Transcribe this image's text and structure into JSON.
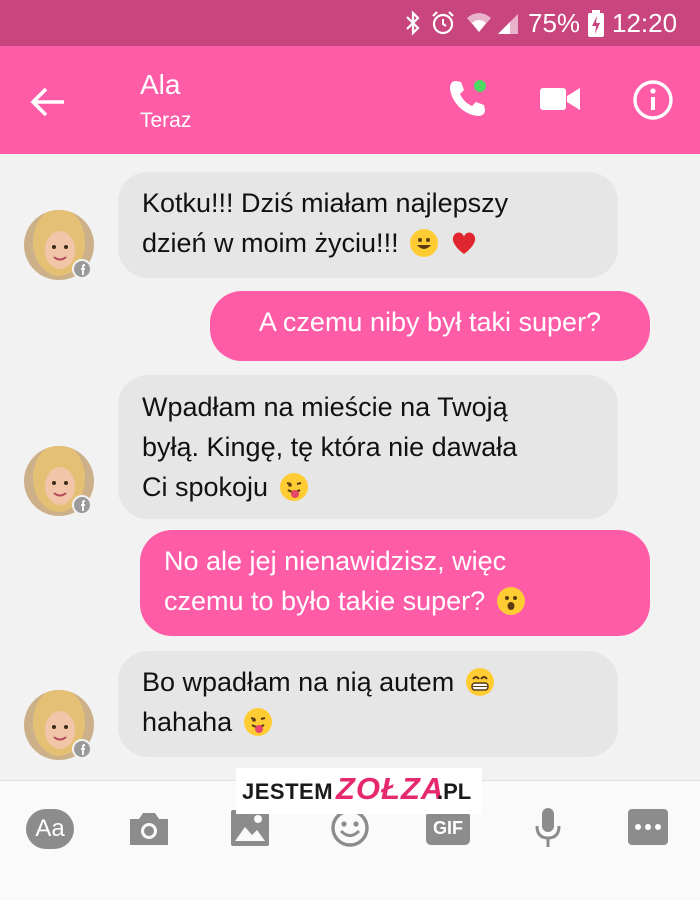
{
  "status_bar": {
    "battery": "75%",
    "time": "12:20"
  },
  "header": {
    "contact_name": "Ala",
    "status": "Teraz"
  },
  "messages": [
    {
      "from": "them",
      "lines": [
        "Kotku!!! Dziś miałam najlepszy",
        "dzień w moim życiu!!!"
      ],
      "emojis": [
        "grinning",
        "red-heart"
      ]
    },
    {
      "from": "me",
      "lines": [
        "A czemu niby był taki super?"
      ],
      "emojis": []
    },
    {
      "from": "them",
      "lines": [
        "Wpadłam na mieście na Twoją",
        "byłą. Kingę, tę która nie dawała",
        "Ci spokoju"
      ],
      "emojis": [
        "tongue-out"
      ]
    },
    {
      "from": "me",
      "lines": [
        "No ale jej nienawidzisz, więc",
        "czemu to było takie super?"
      ],
      "emojis": [
        "astonished"
      ]
    },
    {
      "from": "them",
      "lines": [
        "Bo wpadłam na nią autem",
        "hahaha"
      ],
      "emojis": [
        "grin",
        "tongue-out"
      ]
    }
  ],
  "toolbar": {
    "text_button": "Aa",
    "gif_button": "GIF"
  },
  "watermark": {
    "part1": "JESTEM",
    "part2": "ZOŁZA",
    "part3": ".PL"
  },
  "colors": {
    "header": "#ff5ca8",
    "status_bar": "#c8457e",
    "incoming_bubble": "#e6e6e6",
    "outgoing_bubble": "#ff5ca8"
  }
}
